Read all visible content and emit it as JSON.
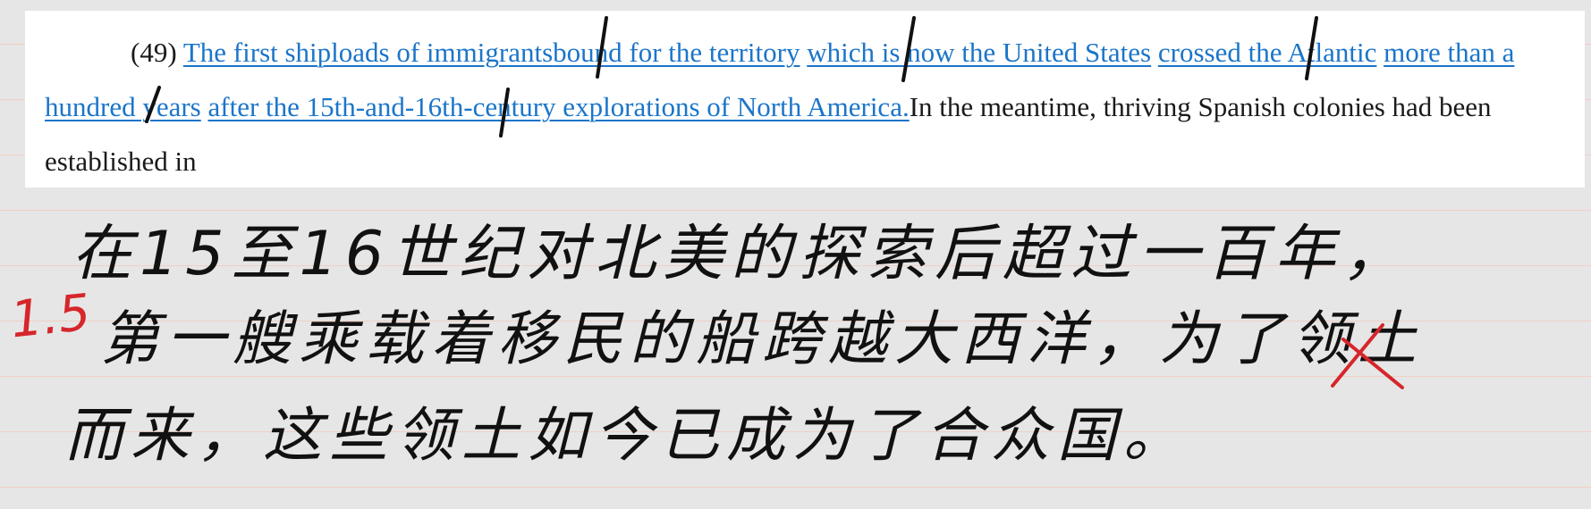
{
  "excerpt": {
    "number": "(49)",
    "highlighted": {
      "seg1": "The first shiploads of immigrants",
      "seg2": "bound for the territory",
      "seg3": "which is now the United States",
      "seg4": "crossed the Atlantic",
      "seg5": "more than a hundred years",
      "seg6": "after the 15th-and-16th-century explorations of North America."
    },
    "continuation": "In the meantime, thriving Spanish colonies had been established in"
  },
  "translation": {
    "line1": "在15至16世纪对北美的探索后超过一百年，",
    "line2": "第一艘乘载着移民的船跨越大西洋，为了领土",
    "line3": "而来，这些领土如今已成为了合众国。"
  },
  "score": "1.5",
  "colors": {
    "highlight": "#1b75c9",
    "annotation": "#d6262b",
    "ink": "#111111"
  }
}
